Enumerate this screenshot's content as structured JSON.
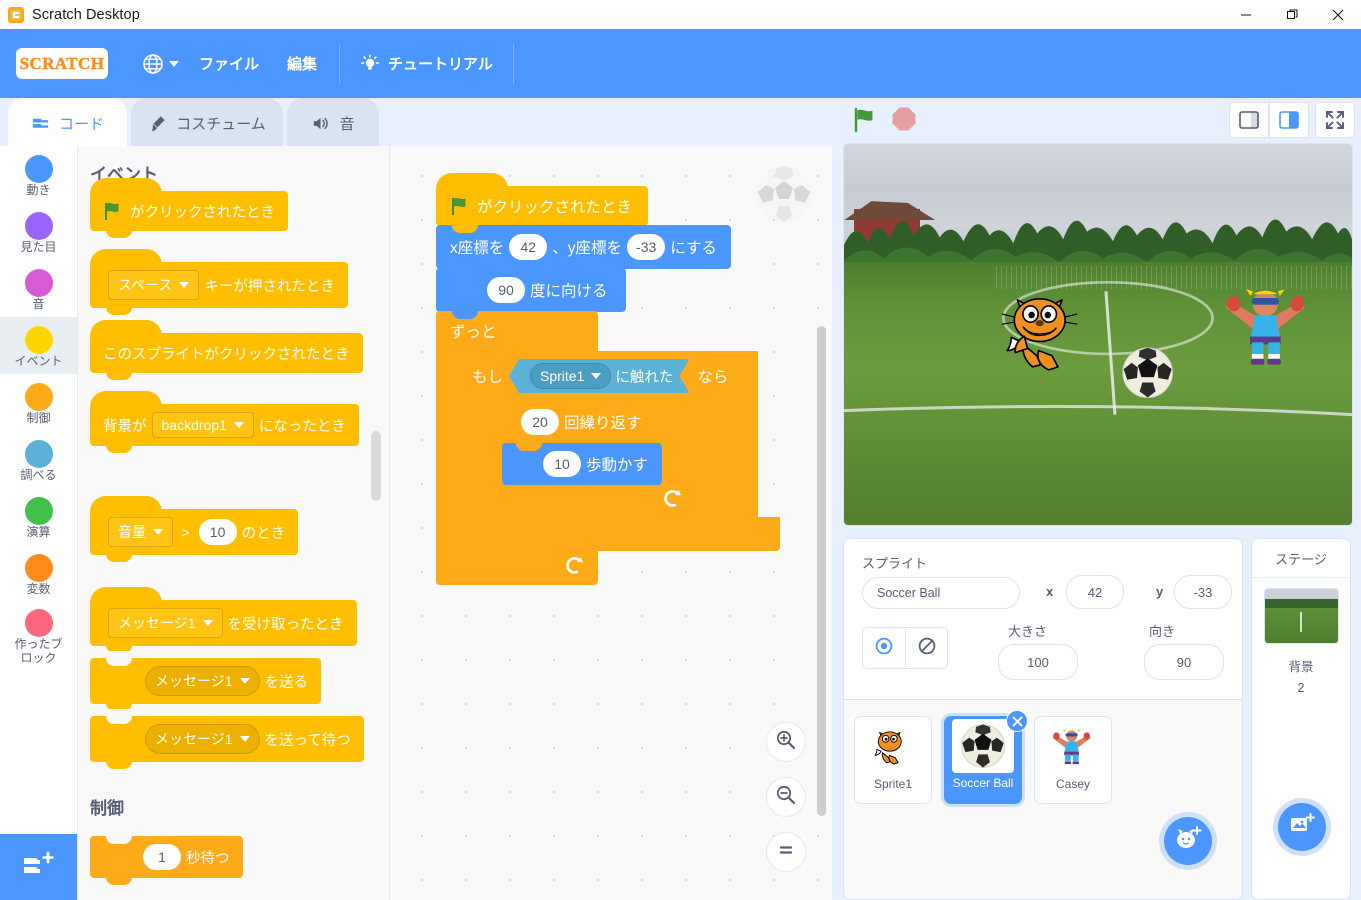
{
  "window": {
    "title": "Scratch Desktop",
    "app_icon": "scratch-app-icon",
    "minimize": "—",
    "maximize": "❐",
    "close": "✕"
  },
  "menubar": {
    "logo": "SCRATCH",
    "globe_icon": "globe-icon",
    "items": [
      {
        "label": "ファイル"
      },
      {
        "label": "編集"
      }
    ],
    "tutorial": {
      "label": "チュートリアル",
      "icon": "lightbulb-icon"
    },
    "accent": "#4c97ff"
  },
  "tabs": [
    {
      "label": "コード",
      "icon": "code-blocks-icon",
      "active": true
    },
    {
      "label": "コスチューム",
      "icon": "paintbrush-icon",
      "active": false
    },
    {
      "label": "音",
      "icon": "speaker-icon",
      "active": false
    }
  ],
  "categories": [
    {
      "label": "動き",
      "color": "#4c97ff",
      "selected": false
    },
    {
      "label": "見た目",
      "color": "#9966ff",
      "selected": false
    },
    {
      "label": "音",
      "color": "#d65cd6",
      "selected": false
    },
    {
      "label": "イベント",
      "color": "#ffd500",
      "selected": true
    },
    {
      "label": "制御",
      "color": "#ffab19",
      "selected": false
    },
    {
      "label": "調べる",
      "color": "#5cb1d6",
      "selected": false
    },
    {
      "label": "演算",
      "color": "#40bf4a",
      "selected": false
    },
    {
      "label": "変数",
      "color": "#ff8c1a",
      "selected": false
    },
    {
      "label": "作ったブロック",
      "color": "#ff6680",
      "selected": false
    }
  ],
  "extension_button": {
    "icon": "add-extension-icon"
  },
  "palette": {
    "section_events": "イベント",
    "section_control": "制御",
    "blocks": {
      "flag_clicked": {
        "text": "がクリックされたとき",
        "icon": "green-flag-icon"
      },
      "key_pressed": {
        "dropdown": "スペース",
        "text": "キーが押されたとき"
      },
      "sprite_clicked": {
        "text": "このスプライトがクリックされたとき"
      },
      "backdrop_switch": {
        "prefix": "背景が",
        "dropdown": "backdrop1",
        "suffix": "になったとき"
      },
      "loudness_gt": {
        "dropdown": "音量",
        "op": ">",
        "value": "10",
        "suffix": "のとき"
      },
      "receive_msg": {
        "dropdown": "メッセージ1",
        "suffix": "を受け取ったとき"
      },
      "broadcast": {
        "dropdown": "メッセージ1",
        "suffix": "を送る"
      },
      "broadcast_wait": {
        "dropdown": "メッセージ1",
        "suffix": "を送って待つ"
      },
      "wait_secs": {
        "value": "1",
        "suffix": "秒待つ"
      }
    }
  },
  "script": {
    "when_flag": {
      "text": "がクリックされたとき",
      "icon": "green-flag-icon"
    },
    "goto_xy": {
      "prefix": "x座標を",
      "x": "42",
      "mid": "、y座標を",
      "y": "-33",
      "suffix": "にする"
    },
    "point_direction": {
      "value": "90",
      "suffix": "度に向ける"
    },
    "forever": {
      "label": "ずっと"
    },
    "if_then": {
      "prefix": "もし",
      "touching_target": "Sprite1",
      "touching_text": "に触れた",
      "suffix": "なら"
    },
    "repeat": {
      "value": "20",
      "suffix": "回繰り返す"
    },
    "move_steps": {
      "value": "10",
      "suffix": "歩動かす"
    },
    "watermark_icon": "soccer-ball-watermark"
  },
  "workspace_controls": {
    "zoom_in": "zoom-in-icon",
    "zoom_out": "zoom-out-icon",
    "zoom_reset": "zoom-reset-icon"
  },
  "stage_controls": {
    "green_flag": "green-flag-icon",
    "stop": "stop-sign-icon",
    "small_stage": "small-stage-icon",
    "large_stage": "large-stage-icon",
    "fullscreen": "fullscreen-icon"
  },
  "sprite_info": {
    "heading": "スプライト",
    "name_value": "Soccer Ball",
    "x_label": "x",
    "x_value": "42",
    "y_label": "y",
    "y_value": "-33",
    "size_label": "大きさ",
    "size_value": "100",
    "direction_label": "向き",
    "direction_value": "90",
    "show_icon": "eye-show-icon",
    "hide_icon": "eye-hide-icon"
  },
  "sprites": [
    {
      "name": "Sprite1",
      "selected": false,
      "thumb": "scratch-cat-thumb"
    },
    {
      "name": "Soccer Ball",
      "selected": true,
      "thumb": "soccer-ball-thumb"
    },
    {
      "name": "Casey",
      "selected": false,
      "thumb": "casey-thumb"
    }
  ],
  "add_sprite_button": {
    "icon": "add-sprite-cat-icon"
  },
  "stage_panel": {
    "heading": "ステージ",
    "backdrop_label": "背景",
    "backdrop_count": "2",
    "add_backdrop_icon": "add-backdrop-icon"
  },
  "stage_scene": {
    "sprites_on_stage": [
      "scratch-cat",
      "soccer-ball",
      "casey"
    ],
    "backdrop": "soccer-field-photo"
  },
  "colors": {
    "accent": "#4c97ff",
    "events_yellow": "#ffbf00",
    "control_orange": "#ffab19",
    "motion_blue": "#4c97ff",
    "sensing_blue": "#5cb1d6",
    "chrome_bg": "#e8f0fe"
  }
}
